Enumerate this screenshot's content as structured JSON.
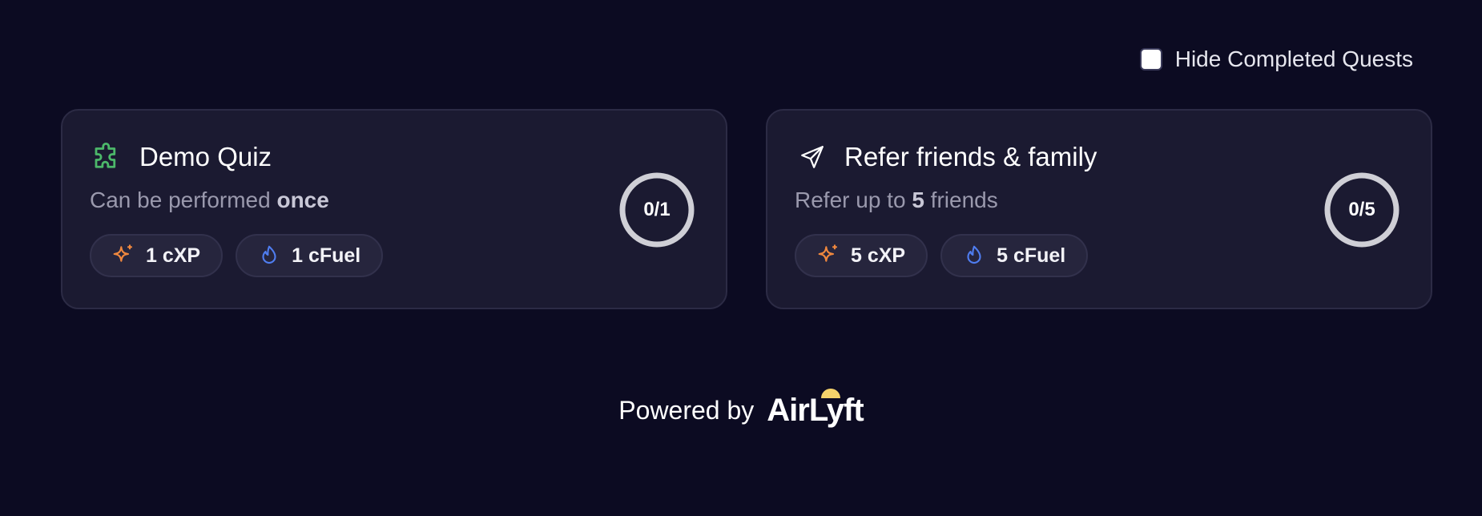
{
  "filter": {
    "label": "Hide Completed Quests",
    "checked": false
  },
  "quests": [
    {
      "icon": "puzzle-icon",
      "icon_color": "#4cb86a",
      "title": "Demo Quiz",
      "desc_prefix": "Can be performed ",
      "desc_bold": "once",
      "desc_suffix": "",
      "rewards": [
        {
          "icon": "sparkle-icon",
          "color": "#f0883e",
          "label": "1 cXP"
        },
        {
          "icon": "flame-icon",
          "color": "#4f7df0",
          "label": "1 cFuel"
        }
      ],
      "progress": "0/1",
      "progress_fraction": 0
    },
    {
      "icon": "send-icon",
      "icon_color": "#ffffff",
      "title": "Refer friends & family",
      "desc_prefix": "Refer up to ",
      "desc_bold": "5",
      "desc_suffix": " friends",
      "rewards": [
        {
          "icon": "sparkle-icon",
          "color": "#f0883e",
          "label": "5 cXP"
        },
        {
          "icon": "flame-icon",
          "color": "#4f7df0",
          "label": "5 cFuel"
        }
      ],
      "progress": "0/5",
      "progress_fraction": 0
    }
  ],
  "footer": {
    "powered_by": "Powered by",
    "brand": "AirLyft",
    "brand_accent": "#f5d36b"
  }
}
